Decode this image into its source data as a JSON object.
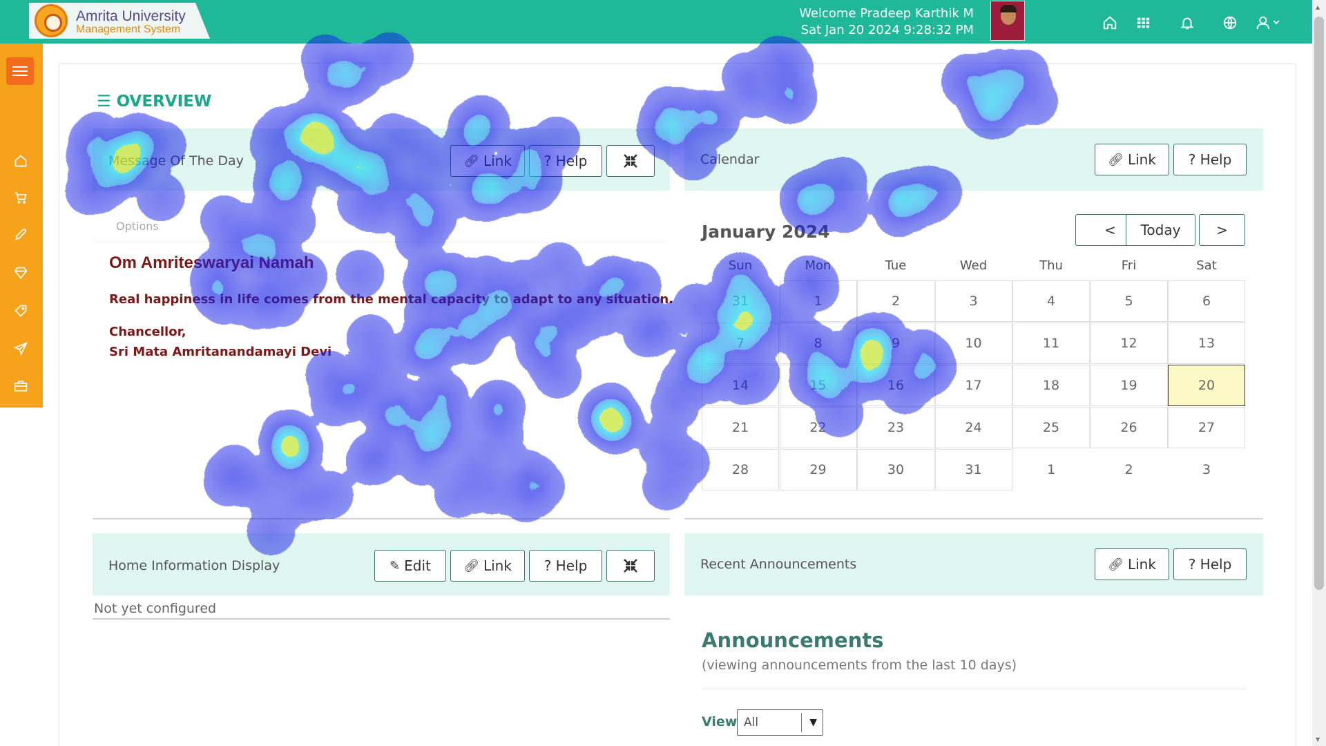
{
  "header": {
    "logo_title": "Amrita University",
    "logo_subtitle": "Management System",
    "welcome": "Welcome Pradeep Karthik M",
    "datetime": "Sat Jan 20 2024 9:28:32 PM",
    "icons": [
      "home-icon",
      "apps-grid-icon",
      "bell-icon",
      "globe-icon",
      "user-icon"
    ]
  },
  "sidebar": {
    "icons": [
      "menu-icon",
      "home-icon",
      "cart-icon",
      "rocket-icon",
      "diamond-icon",
      "tag-icon",
      "paper-plane-icon",
      "briefcase-icon"
    ]
  },
  "page": {
    "title": "OVERVIEW"
  },
  "motd": {
    "title": "Message Of The Day",
    "link": "Link",
    "help": "? Help",
    "options": "Options",
    "heading": "Om Amriteswaryai Namah",
    "quote": "Real happiness in life comes from the mental capacity to adapt to any situation.",
    "sign1": "Chancellor,",
    "sign2": "Sri Mata Amritanandamayi Devi"
  },
  "calendar": {
    "title": "Calendar",
    "link": "Link",
    "help": "? Help",
    "month": "January 2024",
    "prev": "<",
    "today_btn": "Today",
    "next": ">",
    "days": [
      "Sun",
      "Mon",
      "Tue",
      "Wed",
      "Thu",
      "Fri",
      "Sat"
    ],
    "weeks": [
      [
        "31",
        "1",
        "2",
        "3",
        "4",
        "5",
        "6"
      ],
      [
        "7",
        "8",
        "9",
        "10",
        "11",
        "12",
        "13"
      ],
      [
        "14",
        "15",
        "16",
        "17",
        "18",
        "19",
        "20"
      ],
      [
        "21",
        "22",
        "23",
        "24",
        "25",
        "26",
        "27"
      ],
      [
        "28",
        "29",
        "30",
        "31",
        "1",
        "2",
        "3"
      ]
    ],
    "today": "20"
  },
  "home_info": {
    "title": "Home Information Display",
    "edit": "Edit",
    "link": "Link",
    "help": "? Help",
    "body": "Not yet configured"
  },
  "announcements": {
    "panel_title": "Recent Announcements",
    "link": "Link",
    "help": "? Help",
    "heading": "Announcements",
    "subheading": "(viewing announcements from the last 10 days)",
    "view_label": "View",
    "view_value": "All"
  },
  "colors": {
    "header": "#1fb99a",
    "sidebar": "#f6a21b",
    "panel_head": "#e0f6f1",
    "accent": "#1aa88b",
    "motd_text": "#7a1a18",
    "today_cell": "#fcf8c6"
  }
}
